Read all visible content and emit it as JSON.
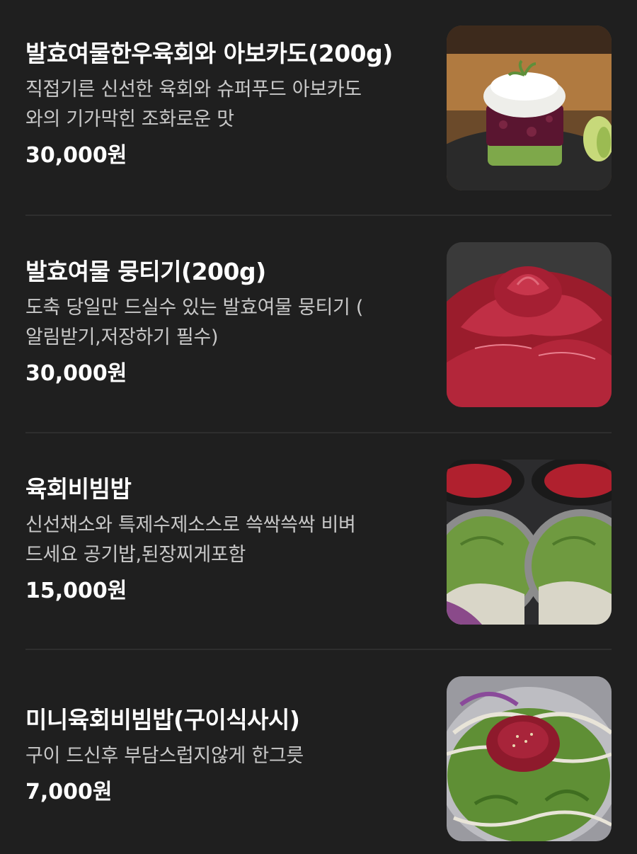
{
  "menu": {
    "items": [
      {
        "name": "발효여물한우육회와 아보카도(200g)",
        "desc_lines": [
          "직접기른 신선한 육회와 슈퍼푸드 아보카도",
          "와의 기가막힌 조화로운 맛"
        ],
        "price": "30,000원",
        "photo_icon": "beef-tartare-avocado-photo"
      },
      {
        "name": "발효여물 뭉티기(200g)",
        "desc_lines": [
          "도축 당일만 드실수 있는 발효여물 뭉티기 (",
          "알림받기,저장하기 필수)"
        ],
        "price": "30,000원",
        "photo_icon": "raw-beef-rose-photo"
      },
      {
        "name": "육회비빔밥",
        "desc_lines": [
          "신선채소와 특제수제소스로 쓱싹쓱싹 비벼",
          "드세요 공기밥,된장찌게포함"
        ],
        "price": "15,000원",
        "photo_icon": "beef-tartare-bibimbap-photo"
      },
      {
        "name": "미니육회비빔밥(구이식사시)",
        "desc_lines": [
          "구이 드신후 부담스럽지않게 한그릇"
        ],
        "price": "7,000원",
        "photo_icon": "mini-bibimbap-photo"
      }
    ]
  }
}
